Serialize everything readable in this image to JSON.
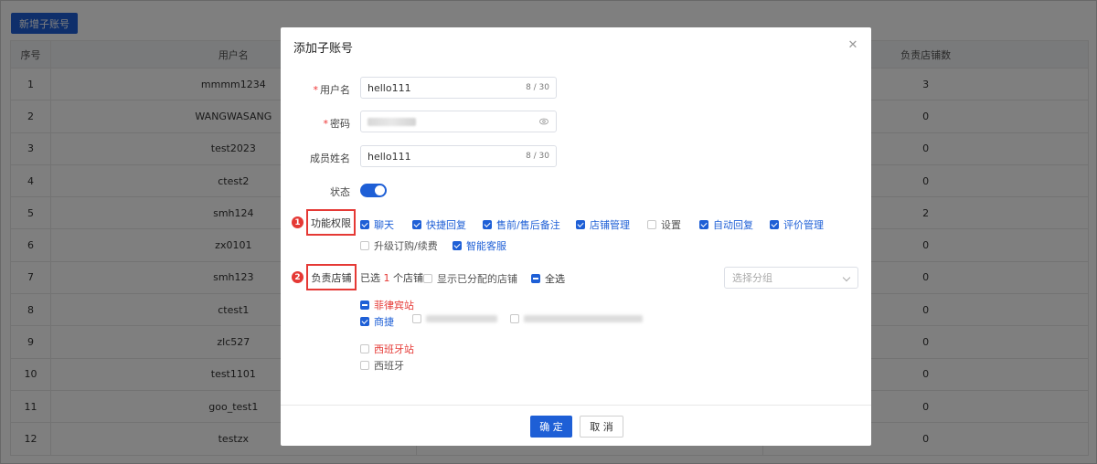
{
  "background": {
    "new_button": "新增子账号",
    "columns": [
      "序号",
      "用户名",
      "负责店铺数"
    ],
    "rows": [
      {
        "idx": "1",
        "user": "mmmm1234",
        "shops": "3"
      },
      {
        "idx": "2",
        "user": "WANGWASANG",
        "shops": "0"
      },
      {
        "idx": "3",
        "user": "test2023",
        "shops": "0"
      },
      {
        "idx": "4",
        "user": "ctest2",
        "shops": "0"
      },
      {
        "idx": "5",
        "user": "smh124",
        "shops": "2"
      },
      {
        "idx": "6",
        "user": "zx0101",
        "shops": "0"
      },
      {
        "idx": "7",
        "user": "smh123",
        "shops": "0"
      },
      {
        "idx": "8",
        "user": "ctest1",
        "shops": "0"
      },
      {
        "idx": "9",
        "user": "zlc527",
        "shops": "0"
      },
      {
        "idx": "10",
        "user": "test1101",
        "shops": "0"
      },
      {
        "idx": "11",
        "user": "goo_test1",
        "shops": "0"
      },
      {
        "idx": "12",
        "user": "testzx",
        "shops": "0"
      }
    ]
  },
  "dialog": {
    "title": "添加子账号",
    "close_icon": "close-icon",
    "username": {
      "label": "用户名",
      "value": "hello111",
      "count": "8 / 30"
    },
    "password": {
      "label": "密码",
      "icon": "eye-icon"
    },
    "member_name": {
      "label": "成员姓名",
      "value": "hello111",
      "count": "8 / 30"
    },
    "status": {
      "label": "状态",
      "enabled": true
    },
    "permissions": {
      "marker": "1",
      "label": "功能权限",
      "items": [
        {
          "label": "聊天",
          "checked": true
        },
        {
          "label": "快捷回复",
          "checked": true
        },
        {
          "label": "售前/售后备注",
          "checked": true
        },
        {
          "label": "店铺管理",
          "checked": true
        },
        {
          "label": "设置",
          "checked": false
        },
        {
          "label": "自动回复",
          "checked": true
        },
        {
          "label": "评价管理",
          "checked": true
        },
        {
          "label": "升级订购/续费",
          "checked": false
        },
        {
          "label": "智能客服",
          "checked": true
        }
      ]
    },
    "shops": {
      "marker": "2",
      "label": "负责店铺",
      "selected_prefix": "已选",
      "selected_count": "1",
      "selected_suffix": "个店铺",
      "show_assigned": "显示已分配的店铺",
      "select_all": "全选",
      "group_placeholder": "选择分组",
      "site1": "菲律宾站",
      "site1_shop": "商捷",
      "site2": "西班牙站",
      "site2_shop": "西班牙"
    },
    "confirm": "确 定",
    "cancel": "取 消"
  },
  "colors": {
    "primary": "#1e5fd6",
    "marker": "#e53935"
  }
}
